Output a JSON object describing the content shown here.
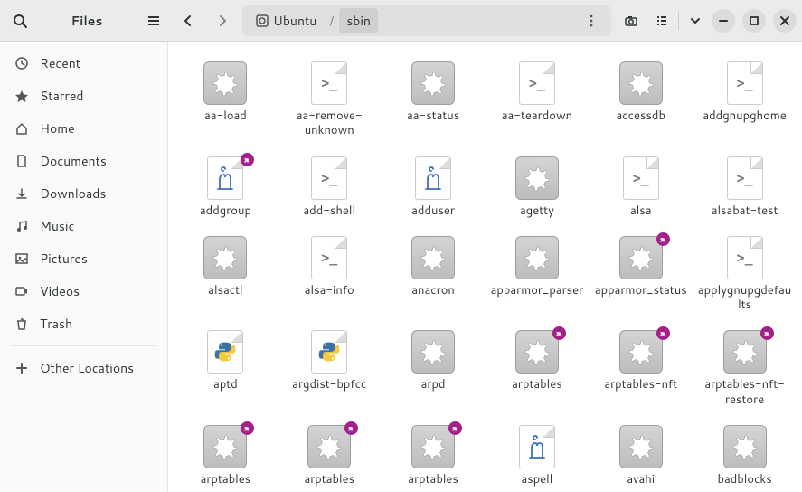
{
  "titlebar": {
    "app_title": "Files",
    "path_root": "Ubuntu",
    "path_current": "sbin"
  },
  "sidebar": {
    "items": [
      {
        "id": "recent",
        "label": "Recent",
        "icon": "clock"
      },
      {
        "id": "starred",
        "label": "Starred",
        "icon": "star"
      },
      {
        "id": "home",
        "label": "Home",
        "icon": "home"
      },
      {
        "id": "documents",
        "label": "Documents",
        "icon": "doc"
      },
      {
        "id": "downloads",
        "label": "Downloads",
        "icon": "down"
      },
      {
        "id": "music",
        "label": "Music",
        "icon": "music"
      },
      {
        "id": "pictures",
        "label": "Pictures",
        "icon": "pic"
      },
      {
        "id": "videos",
        "label": "Videos",
        "icon": "vid"
      },
      {
        "id": "trash",
        "label": "Trash",
        "icon": "trash"
      }
    ],
    "other": {
      "label": "Other Locations"
    }
  },
  "files": [
    {
      "name": "aa-load",
      "type": "exec",
      "link": false
    },
    {
      "name": "aa-remove-unknown",
      "type": "script",
      "link": false
    },
    {
      "name": "aa-status",
      "type": "exec",
      "link": false
    },
    {
      "name": "aa-teardown",
      "type": "script",
      "link": false
    },
    {
      "name": "accessdb",
      "type": "exec",
      "link": false
    },
    {
      "name": "addgnupghome",
      "type": "script",
      "link": false
    },
    {
      "name": "addgroup",
      "type": "perl",
      "link": true
    },
    {
      "name": "add-shell",
      "type": "script",
      "link": false
    },
    {
      "name": "adduser",
      "type": "perl",
      "link": false
    },
    {
      "name": "agetty",
      "type": "exec",
      "link": false
    },
    {
      "name": "alsa",
      "type": "script",
      "link": false
    },
    {
      "name": "alsabat-test",
      "type": "script",
      "link": false
    },
    {
      "name": "alsactl",
      "type": "exec",
      "link": false
    },
    {
      "name": "alsa-info",
      "type": "script",
      "link": false
    },
    {
      "name": "anacron",
      "type": "exec",
      "link": false
    },
    {
      "name": "apparmor_parser",
      "type": "exec",
      "link": false
    },
    {
      "name": "apparmor_status",
      "type": "exec",
      "link": true
    },
    {
      "name": "applygnupgdefaults",
      "type": "script",
      "link": false
    },
    {
      "name": "aptd",
      "type": "python",
      "link": false
    },
    {
      "name": "argdist-bpfcc",
      "type": "python",
      "link": false
    },
    {
      "name": "arpd",
      "type": "exec",
      "link": false
    },
    {
      "name": "arptables",
      "type": "exec",
      "link": true
    },
    {
      "name": "arptables-nft",
      "type": "exec",
      "link": true
    },
    {
      "name": "arptables-nft-restore",
      "type": "exec",
      "link": true
    },
    {
      "name": "arptables",
      "type": "exec",
      "link": true
    },
    {
      "name": "arptables",
      "type": "exec",
      "link": true
    },
    {
      "name": "arptables",
      "type": "exec",
      "link": true
    },
    {
      "name": "aspell",
      "type": "perl",
      "link": false
    },
    {
      "name": "avahi",
      "type": "exec",
      "link": false
    },
    {
      "name": "badblocks",
      "type": "exec",
      "link": false
    }
  ]
}
